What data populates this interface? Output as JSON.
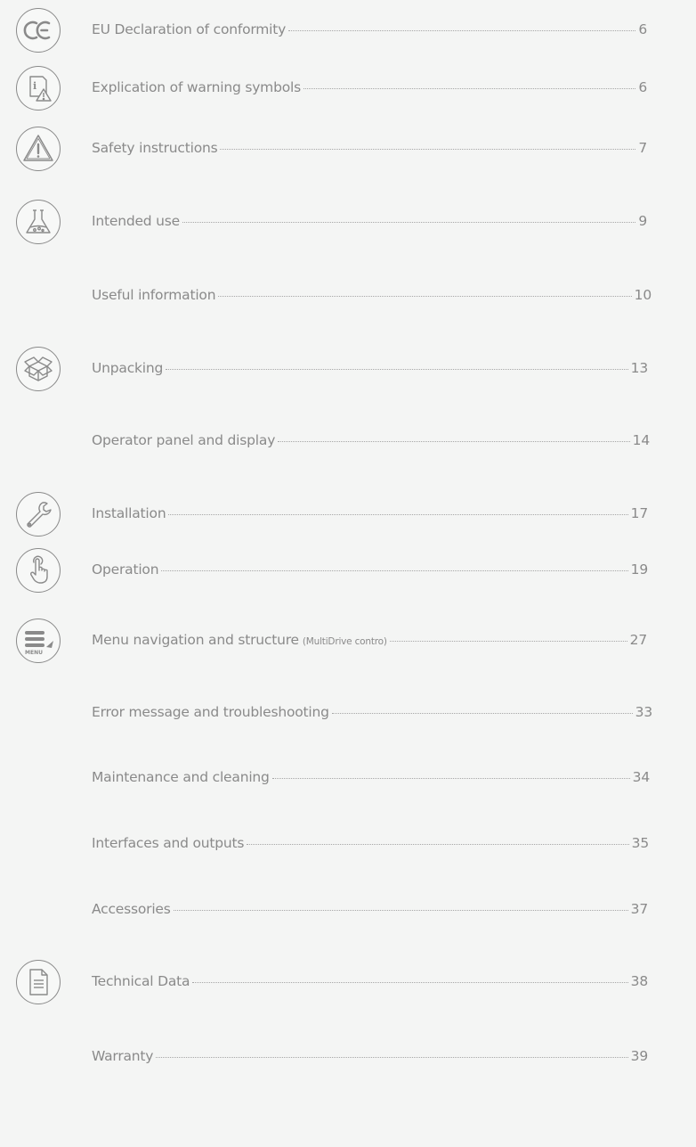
{
  "toc": [
    {
      "title": "EU Declaration of conformity",
      "page": "6",
      "icon": "ce-mark-icon"
    },
    {
      "title": "Explication of warning symbols",
      "page": "6",
      "icon": "info-warning-icon"
    },
    {
      "title": "Safety instructions",
      "page": "7",
      "icon": "warning-triangle-icon"
    },
    {
      "title": "Intended use",
      "page": "9",
      "icon": "flask-icon"
    },
    {
      "title": "Useful information",
      "page": "10",
      "icon": ""
    },
    {
      "title": "Unpacking",
      "page": "13",
      "icon": "box-icon"
    },
    {
      "title": "Operator panel and display",
      "page": "14",
      "icon": ""
    },
    {
      "title": "Installation",
      "page": "17",
      "icon": "wrench-icon"
    },
    {
      "title": "Operation",
      "page": "19",
      "icon": "hand-pointer-icon"
    },
    {
      "title": "Menu navigation and structure",
      "subtitle": "(MultiDrive contro)",
      "page": "27",
      "icon": "menu-icon"
    },
    {
      "title": "Error message and troubleshooting",
      "page": "33",
      "icon": ""
    },
    {
      "title": "Maintenance and cleaning",
      "page": "34",
      "icon": ""
    },
    {
      "title": "Interfaces and outputs",
      "page": "35",
      "icon": ""
    },
    {
      "title": "Accessories",
      "page": "37",
      "icon": ""
    },
    {
      "title": "Technical Data",
      "page": "38",
      "icon": "document-icon"
    },
    {
      "title": "Warranty",
      "page": "39",
      "icon": ""
    }
  ],
  "icon_labels": {
    "menu": "MENU"
  },
  "colors": {
    "text": "#8a8a8a",
    "background": "#f4f5f4",
    "icon_stroke": "#8a8a8a"
  }
}
